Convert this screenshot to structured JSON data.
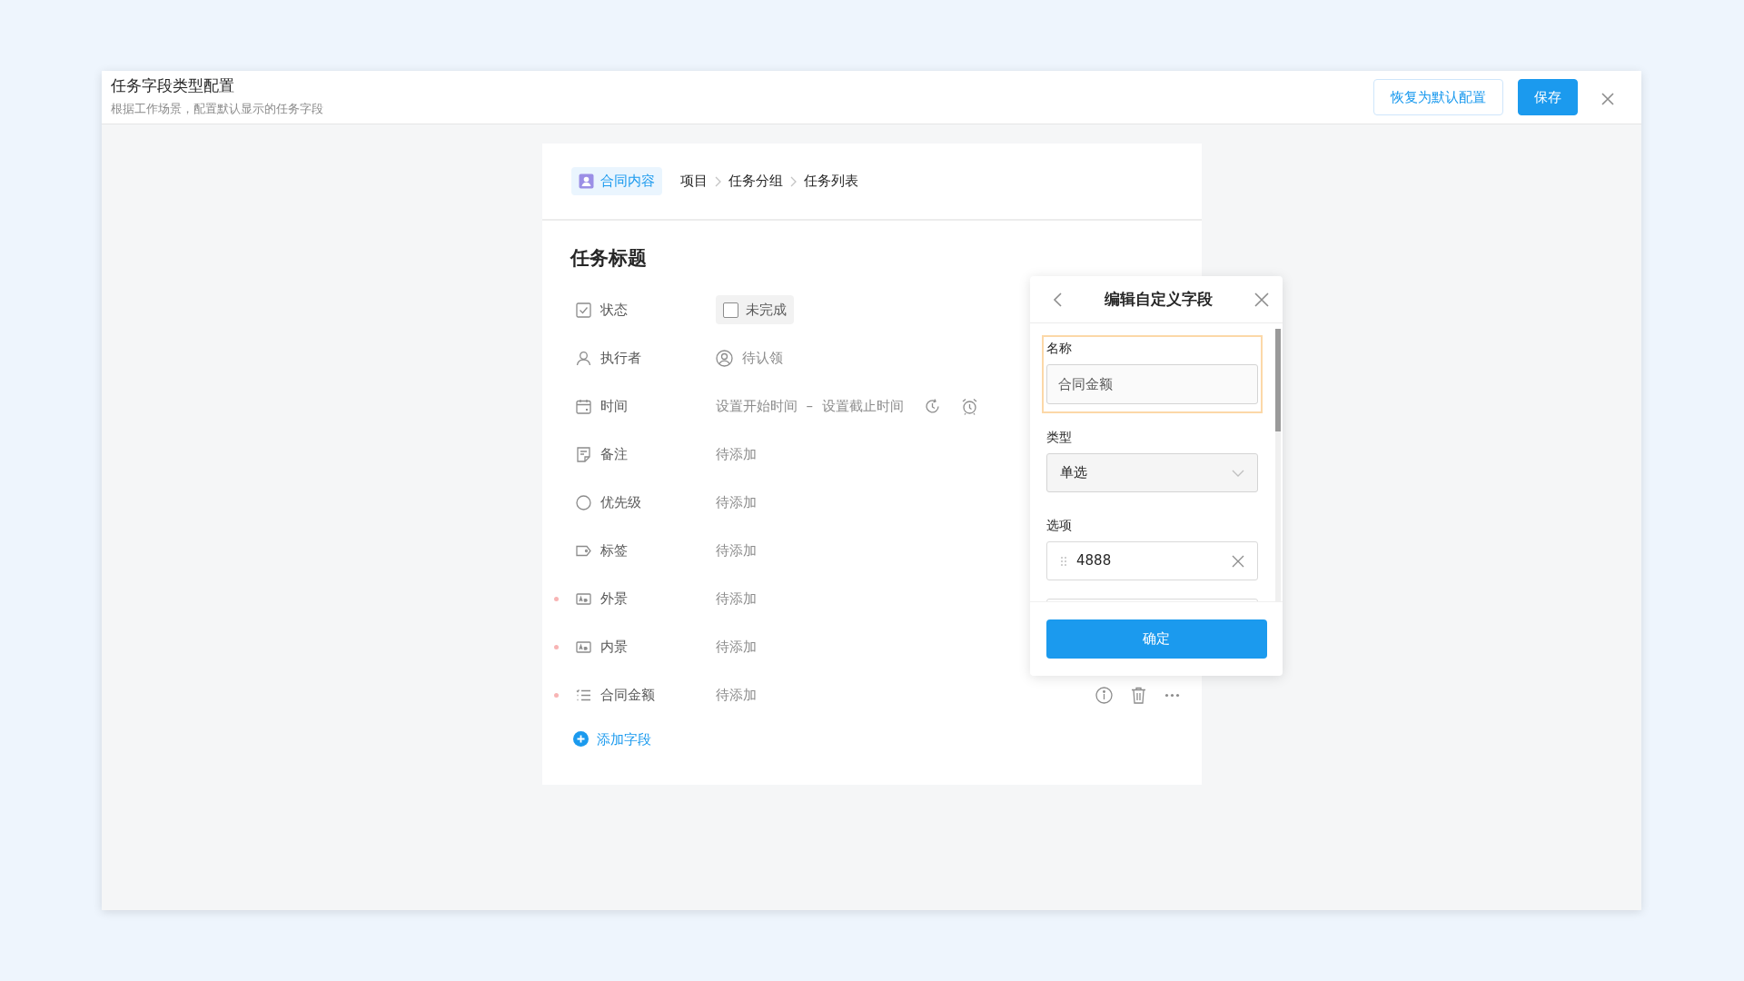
{
  "header": {
    "title": "任务字段类型配置",
    "subtitle": "根据工作场景，配置默认显示的任务字段",
    "buttons": [
      {
        "label": "恢复为默认配置",
        "kind": "outline"
      },
      {
        "label": "保存",
        "kind": "primary"
      }
    ]
  },
  "breadcrumb": {
    "tag": "合同内容",
    "items": [
      "项目",
      "任务分组",
      "任务列表"
    ]
  },
  "task_title": "任务标题",
  "fields": [
    {
      "label": "状态",
      "required": false,
      "kind": "status",
      "value": "未完成",
      "checked": false
    },
    {
      "label": "执行者",
      "required": false,
      "kind": "assignee",
      "value": "待认领"
    },
    {
      "label": "时间",
      "required": false,
      "kind": "time",
      "value": "设置开始时间",
      "separator": "–",
      "end": "设置截止时间"
    },
    {
      "label": "备注",
      "required": false,
      "kind": "plain",
      "value": "待添加"
    },
    {
      "label": "优先级",
      "required": false,
      "kind": "plain",
      "value": "待添加"
    },
    {
      "label": "标签",
      "required": false,
      "kind": "plain",
      "value": "待添加"
    },
    {
      "label": "外景",
      "required": true,
      "kind": "plain",
      "value": "待添加"
    },
    {
      "label": "内景",
      "required": true,
      "kind": "plain",
      "value": "待添加"
    },
    {
      "label": "合同金额",
      "required": true,
      "kind": "plain",
      "value": "待添加",
      "hovered": true
    }
  ],
  "add_field": "添加字段",
  "editor": {
    "title": "编辑自定义字段",
    "name_label": "名称",
    "name_value": "合同金额",
    "type_label": "类型",
    "type_value": "单选",
    "options_label": "选项",
    "options": [
      "4888"
    ],
    "confirm": "确定"
  }
}
